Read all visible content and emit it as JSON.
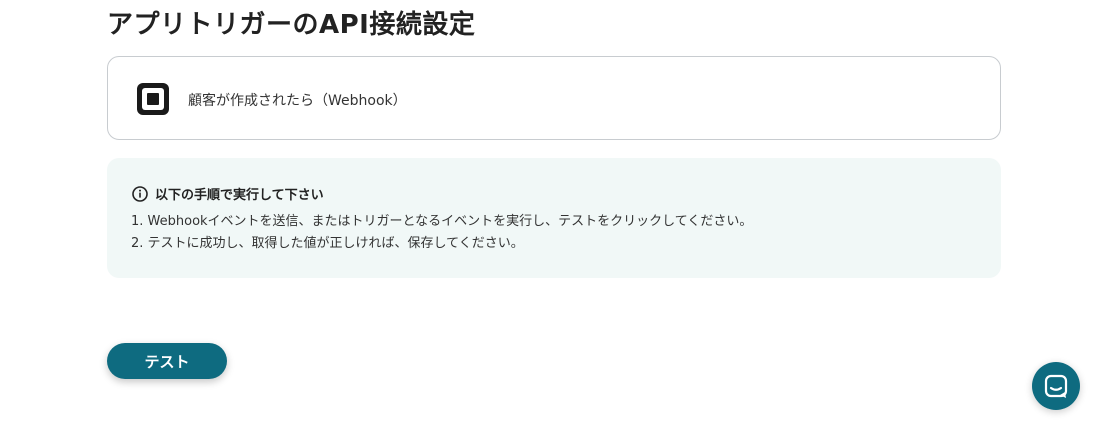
{
  "page": {
    "title": "アプリトリガーのAPI接続設定"
  },
  "trigger": {
    "app_icon": "square-logo-icon",
    "label": "顧客が作成されたら（Webhook）"
  },
  "instructions": {
    "icon": "info-circle-icon",
    "title": "以下の手順で実行して下さい",
    "steps": [
      "1. Webhookイベントを送信、またはトリガーとなるイベントを実行し、テストをクリックしてください。",
      "2. テストに成功し、取得した値が正しければ、保存してください。"
    ]
  },
  "actions": {
    "test_label": "テスト"
  },
  "chat": {
    "icon": "chat-bubble-icon"
  },
  "colors": {
    "accent": "#0e6b80",
    "info_background": "#f1f8f7",
    "card_border": "#c8ccd0",
    "text": "#222222"
  }
}
